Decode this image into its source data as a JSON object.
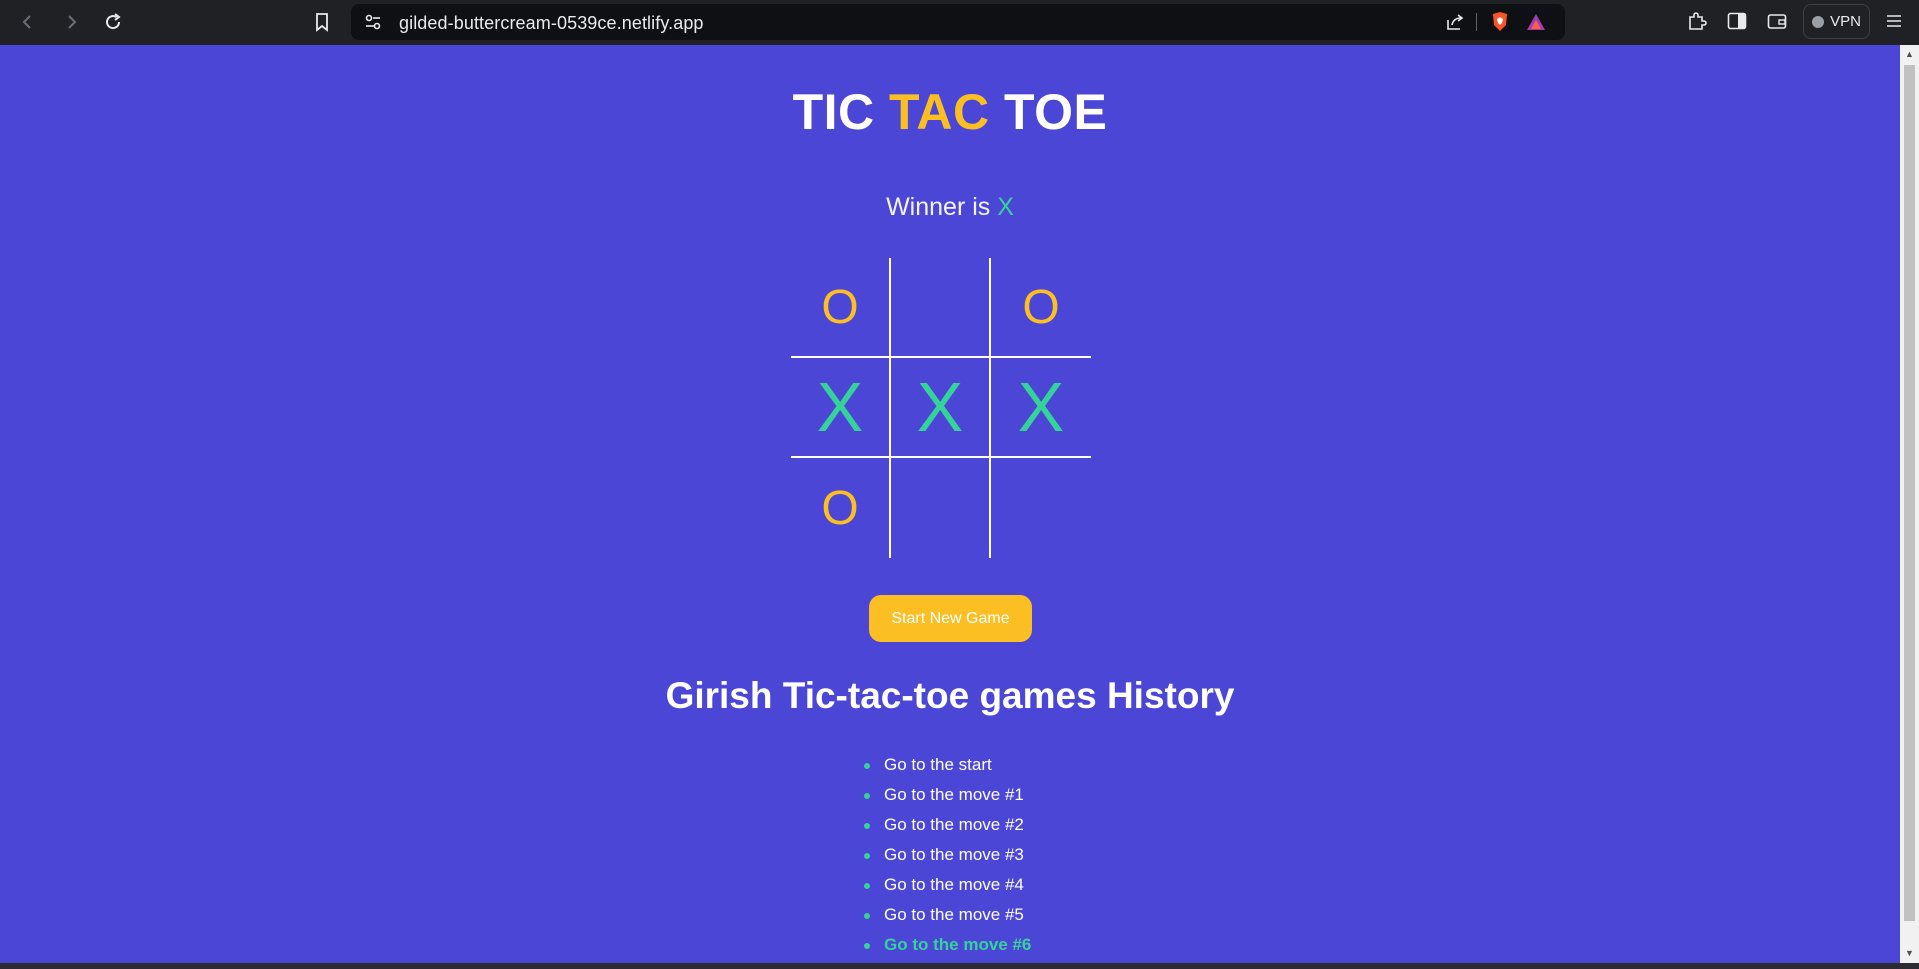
{
  "browser": {
    "url": "gilded-buttercream-0539ce.netlify.app",
    "vpn_label": "VPN",
    "icons": [
      "back-icon",
      "forward-icon",
      "reload-icon",
      "bookmark-icon",
      "site-settings-icon",
      "share-icon",
      "brave-shields-icon",
      "brave-rewards-icon",
      "extensions-icon",
      "sidebar-icon",
      "wallet-icon",
      "menu-icon"
    ]
  },
  "game": {
    "title_part1": "TIC",
    "title_part2": "TAC",
    "title_part3": "TOE",
    "status_prefix": "Winner is",
    "winner": "X",
    "board": [
      [
        "O",
        "",
        "O"
      ],
      [
        "X",
        "X",
        "X"
      ],
      [
        "O",
        "",
        ""
      ]
    ],
    "new_game_label": "Start New Game"
  },
  "history": {
    "title": "Girish Tic-tac-toe games History",
    "moves": [
      "Go to the start",
      "Go to the move #1",
      "Go to the move #2",
      "Go to the move #3",
      "Go to the move #4",
      "Go to the move #5",
      "Go to the move #6"
    ],
    "current_index": 6
  },
  "colors": {
    "background": "#4b46d6",
    "accent_yellow": "#fbbf24",
    "accent_green": "#34d399"
  }
}
